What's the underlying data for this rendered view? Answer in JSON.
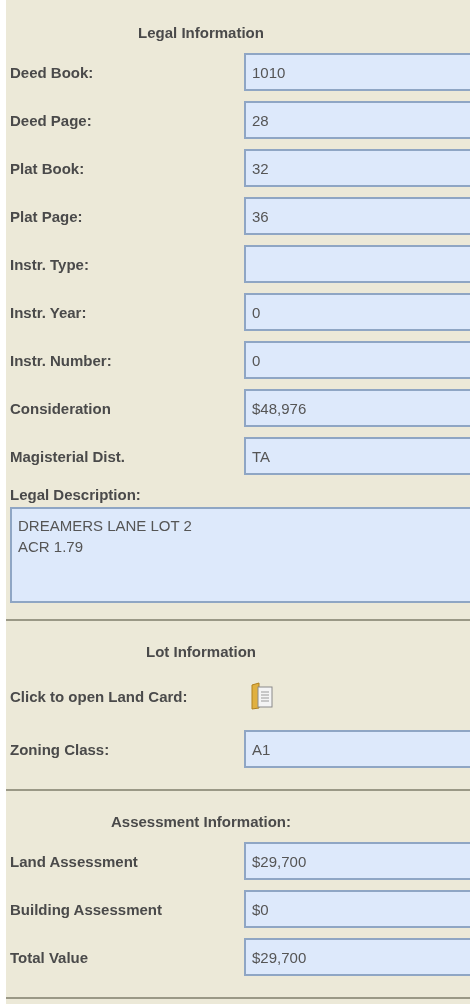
{
  "sections": [
    {
      "title": "Legal Information",
      "rows": [
        {
          "kind": "field",
          "label": "Deed Book:",
          "value": "1010"
        },
        {
          "kind": "field",
          "label": "Deed Page:",
          "value": "28"
        },
        {
          "kind": "field",
          "label": "Plat Book:",
          "value": "32"
        },
        {
          "kind": "field",
          "label": "Plat Page:",
          "value": "36"
        },
        {
          "kind": "field",
          "label": "Instr. Type:"
        },
        {
          "kind": "field",
          "label": "Instr. Year:",
          "value": "0"
        },
        {
          "kind": "field",
          "label": "Instr. Number:",
          "value": "0"
        },
        {
          "kind": "field",
          "label": "Consideration",
          "value": "$48,976"
        },
        {
          "kind": "field",
          "label": "Magisterial Dist.",
          "value": "TA"
        },
        {
          "kind": "textarea",
          "label": "Legal Description:",
          "lines": [
            "DREAMERS LANE LOT 2",
            "ACR 1.79"
          ]
        }
      ]
    },
    {
      "title": "Lot Information",
      "rows": [
        {
          "kind": "icon",
          "label": "Click to open Land Card:"
        },
        {
          "kind": "field",
          "label": "Zoning Class:",
          "value": "A1"
        }
      ]
    },
    {
      "title": "Assessment Information:",
      "rows": [
        {
          "kind": "field",
          "label": "Land Assessment",
          "value": "$29,700"
        },
        {
          "kind": "field",
          "label": "Building Assessment",
          "value": "$0"
        },
        {
          "kind": "field",
          "label": "Total Value",
          "value": "$29,700"
        }
      ]
    }
  ]
}
